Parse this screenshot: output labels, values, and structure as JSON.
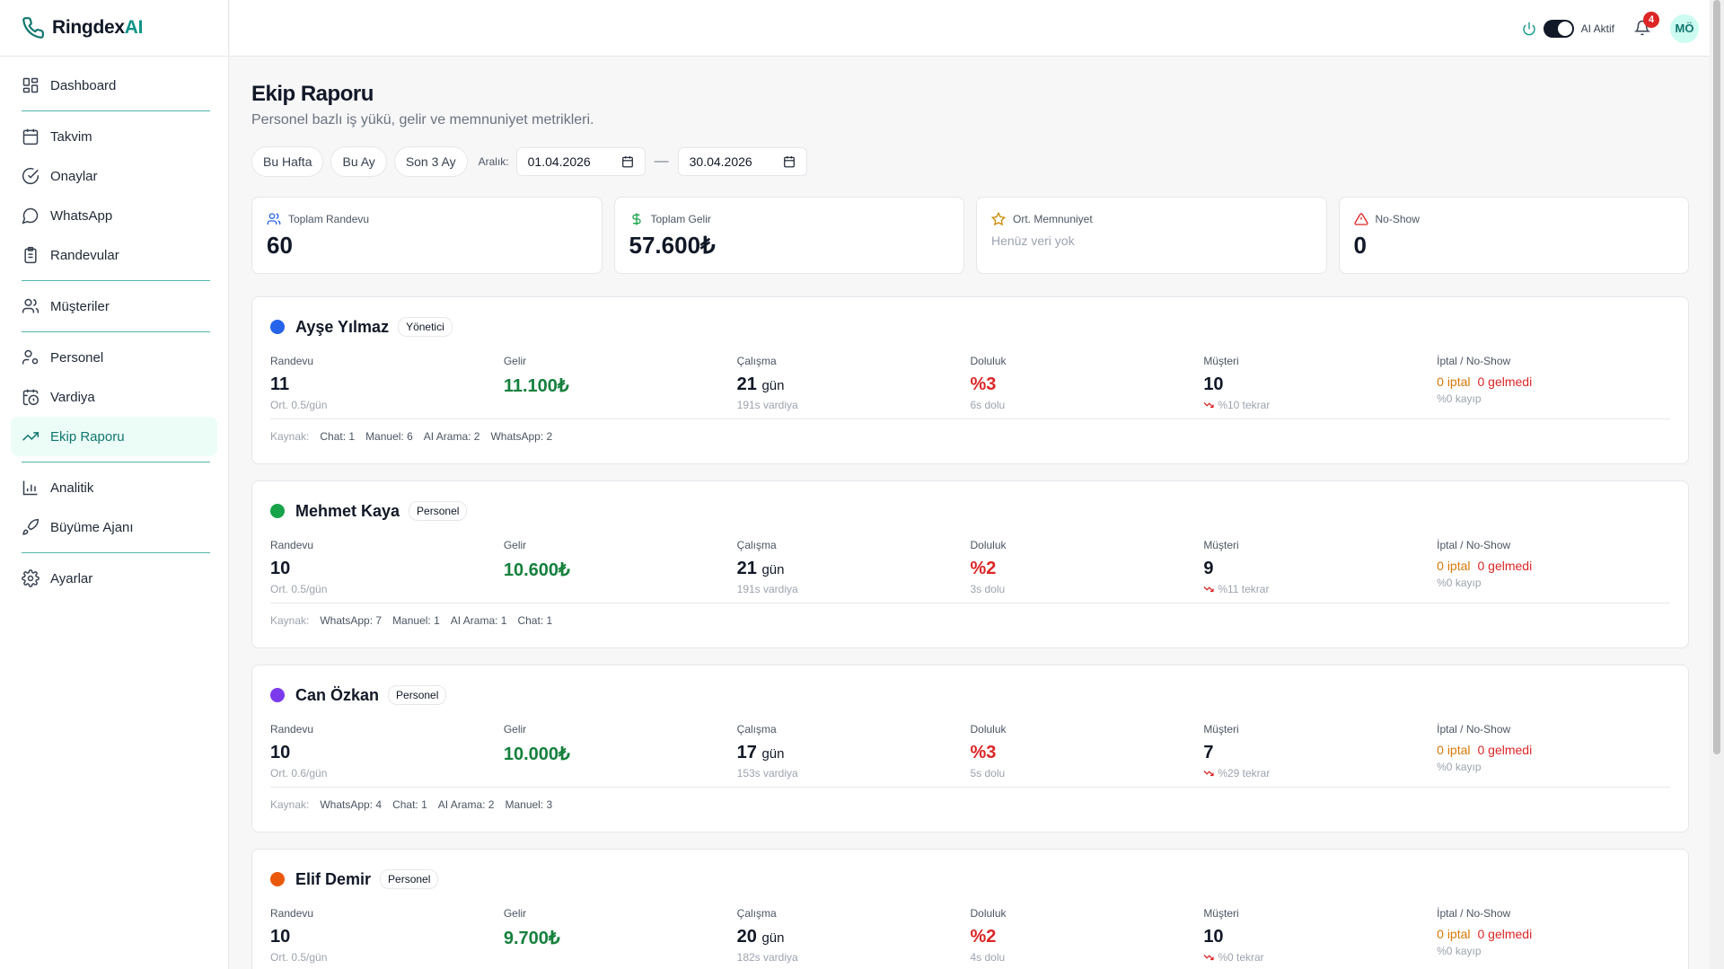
{
  "brand": {
    "name_main": "Ringdex",
    "name_ai": "AI"
  },
  "sidebar": {
    "items": [
      {
        "label": "Dashboard",
        "icon": "layout-grid-icon"
      },
      {
        "label": "Takvim",
        "icon": "calendar-icon"
      },
      {
        "label": "Onaylar",
        "icon": "check-circle-icon"
      },
      {
        "label": "WhatsApp",
        "icon": "message-circle-icon"
      },
      {
        "label": "Randevular",
        "icon": "clipboard-icon"
      },
      {
        "label": "Müşteriler",
        "icon": "users-icon"
      },
      {
        "label": "Personel",
        "icon": "user-cog-icon"
      },
      {
        "label": "Vardiya",
        "icon": "calendar-clock-icon"
      },
      {
        "label": "Ekip Raporu",
        "icon": "trending-up-icon"
      },
      {
        "label": "Analitik",
        "icon": "bar-chart-icon"
      },
      {
        "label": "Büyüme Ajanı",
        "icon": "rocket-icon"
      },
      {
        "label": "Ayarlar",
        "icon": "settings-icon"
      }
    ],
    "active": "Ekip Raporu"
  },
  "topbar": {
    "ai_label": "AI Aktif",
    "notifications": "4",
    "avatar": "MÖ"
  },
  "page": {
    "title": "Ekip Raporu",
    "subtitle": "Personel bazlı iş yükü, gelir ve memnuniyet metrikleri."
  },
  "filters": {
    "chips": [
      "Bu Hafta",
      "Bu Ay",
      "Son 3 Ay"
    ],
    "range_label": "Aralık:",
    "start": "01.04.2026",
    "end": "30.04.2026",
    "separator": "—"
  },
  "stats": {
    "total_appointments": {
      "label": "Toplam Randevu",
      "value": "60"
    },
    "total_income": {
      "label": "Toplam Gelir",
      "value": "57.600₺"
    },
    "satisfaction": {
      "label": "Ort. Memnuniyet",
      "value": "Henüz veri yok"
    },
    "no_show": {
      "label": "No-Show",
      "value": "0"
    }
  },
  "labels": {
    "appointments": "Randevu",
    "income": "Gelir",
    "work": "Çalışma",
    "occupancy": "Doluluk",
    "customers": "Müşteri",
    "cancel": "İptal / No-Show",
    "sources": "Kaynak:",
    "day_unit": "gün"
  },
  "staff": [
    {
      "name": "Ayşe Yılmaz",
      "role": "Yönetici",
      "color": "#2563eb",
      "appointments": "11",
      "avg": "Ort. 0.5/gün",
      "income": "11.100₺",
      "work_days": "21",
      "shift": "191s vardiya",
      "occupancy": "%3",
      "occ_sub": "6s dolu",
      "customers": "10",
      "repeat": "%10 tekrar",
      "cancel": "0 iptal",
      "noshow": "0 gelmedi",
      "loss": "%0 kayıp",
      "sources": [
        "Chat: 1",
        "Manuel: 6",
        "AI Arama: 2",
        "WhatsApp: 2"
      ]
    },
    {
      "name": "Mehmet Kaya",
      "role": "Personel",
      "color": "#16a34a",
      "appointments": "10",
      "avg": "Ort. 0.5/gün",
      "income": "10.600₺",
      "work_days": "21",
      "shift": "191s vardiya",
      "occupancy": "%2",
      "occ_sub": "3s dolu",
      "customers": "9",
      "repeat": "%11 tekrar",
      "cancel": "0 iptal",
      "noshow": "0 gelmedi",
      "loss": "%0 kayıp",
      "sources": [
        "WhatsApp: 7",
        "Manuel: 1",
        "AI Arama: 1",
        "Chat: 1"
      ]
    },
    {
      "name": "Can Özkan",
      "role": "Personel",
      "color": "#7c3aed",
      "appointments": "10",
      "avg": "Ort. 0.6/gün",
      "income": "10.000₺",
      "work_days": "17",
      "shift": "153s vardiya",
      "occupancy": "%3",
      "occ_sub": "5s dolu",
      "customers": "7",
      "repeat": "%29 tekrar",
      "cancel": "0 iptal",
      "noshow": "0 gelmedi",
      "loss": "%0 kayıp",
      "sources": [
        "WhatsApp: 4",
        "Chat: 1",
        "AI Arama: 2",
        "Manuel: 3"
      ]
    },
    {
      "name": "Elif Demir",
      "role": "Personel",
      "color": "#ea580c",
      "appointments": "10",
      "avg": "Ort. 0.5/gün",
      "income": "9.700₺",
      "work_days": "20",
      "shift": "182s vardiya",
      "occupancy": "%2",
      "occ_sub": "4s dolu",
      "customers": "10",
      "repeat": "%0 tekrar",
      "cancel": "0 iptal",
      "noshow": "0 gelmedi",
      "loss": "%0 kayıp",
      "sources": []
    }
  ]
}
